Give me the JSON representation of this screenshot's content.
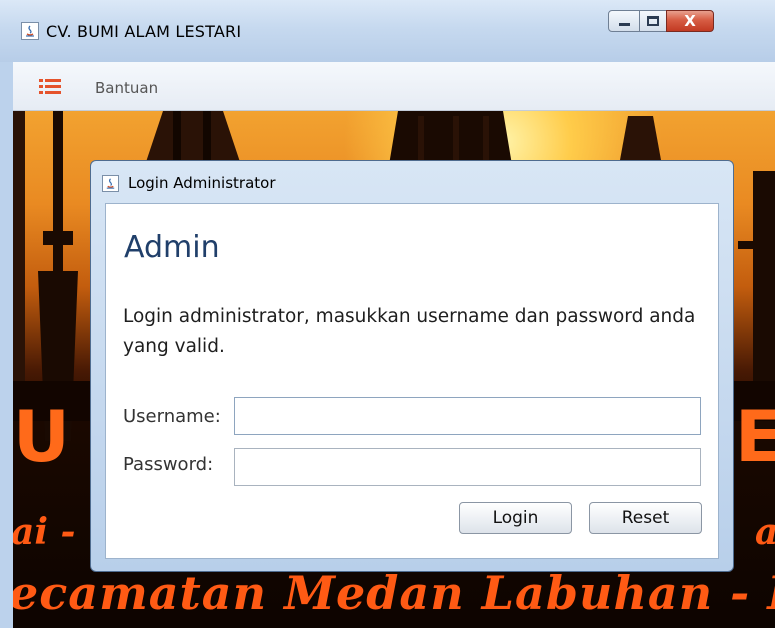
{
  "window": {
    "title": "CV. BUMI ALAM LESTARI",
    "controls": {
      "close_glyph": "X"
    }
  },
  "menubar": {
    "menu_icon": "hamburger-list-icon",
    "items": [
      {
        "label": "Bantuan"
      }
    ]
  },
  "background": {
    "slogan_line": "ecamatan Medan Labuhan - Kota Med",
    "partial_left": "ai -",
    "partial_right": "a"
  },
  "dialog": {
    "title": "Login Administrator",
    "heading": "Admin",
    "description": "Login administrator, masukkan username dan password anda yang valid.",
    "username_label": "Username:",
    "username_value": "",
    "password_label": "Password:",
    "password_value": "",
    "login_button": "Login",
    "reset_button": "Reset"
  },
  "colors": {
    "accent_orange": "#e5532c",
    "heading_blue": "#203f6a"
  }
}
